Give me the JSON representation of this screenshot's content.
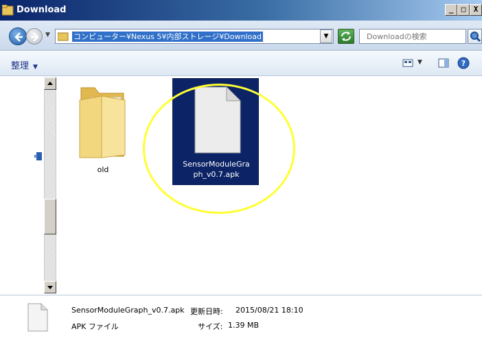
{
  "window": {
    "title": "Download",
    "minimize_glyph": "_",
    "maximize_glyph": "□",
    "close_glyph": "X"
  },
  "address_bar": {
    "path": "コンピューター¥Nexus 5¥内部ストレージ¥Download",
    "search_placeholder": "Downloadの検索"
  },
  "toolbar": {
    "organize_label": "整理",
    "organize_caret": "▼",
    "view_caret": "▼"
  },
  "files": [
    {
      "name": "old",
      "type": "folder",
      "selected": false
    },
    {
      "name_line1": "SensorModuleGra",
      "name_line2": "ph_v0.7.apk",
      "type": "apk",
      "selected": true
    }
  ],
  "details": {
    "filename": "SensorModuleGraph_v0.7.apk",
    "filetype": "APK ファイル",
    "modified_label": "更新日時:",
    "modified_value": "2015/08/21 18:10",
    "size_label": "サイズ:",
    "size_value": "1.39 MB"
  },
  "colors": {
    "selection": "#0c2466",
    "highlight_circle": "#ffff33",
    "title_bar": "#0a246a"
  }
}
